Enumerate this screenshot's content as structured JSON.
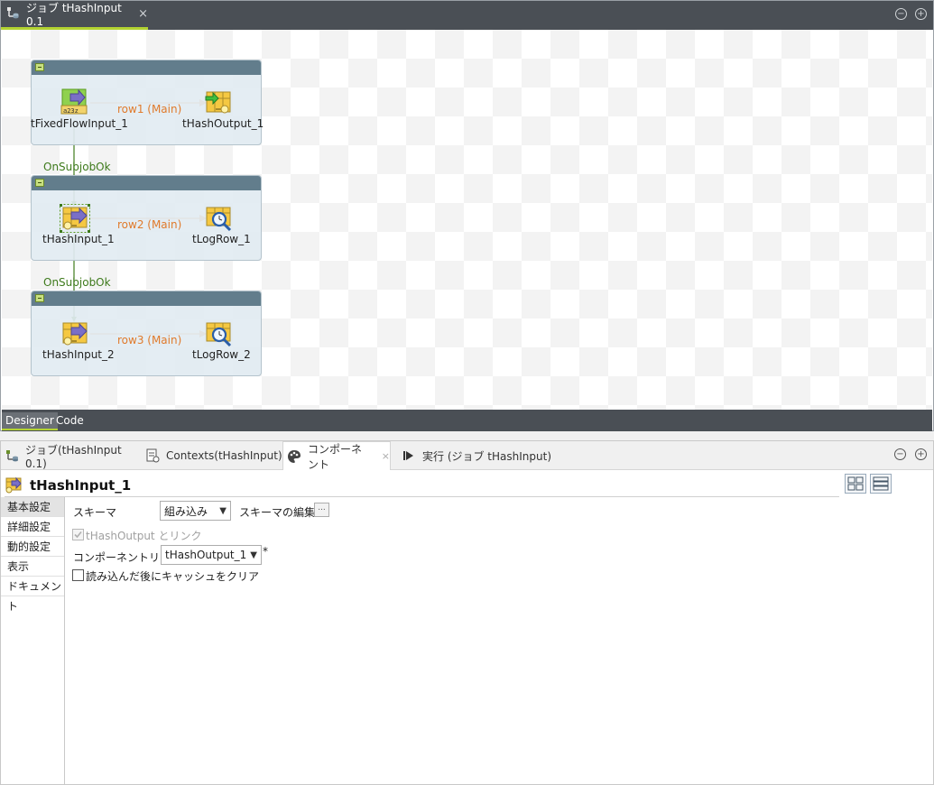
{
  "editor": {
    "tab_title": "ジョブ tHashInput 0.1",
    "tab_close": "×",
    "minimize": "−",
    "maximize": "+"
  },
  "canvas": {
    "components": {
      "fixed_flow_input": "tFixedFlowInput_1",
      "hash_output": "tHashOutput_1",
      "hash_input_1": "tHashInput_1",
      "log_row_1": "tLogRow_1",
      "hash_input_2": "tHashInput_2",
      "log_row_2": "tLogRow_2"
    },
    "flows": {
      "row1": "row1 (Main)",
      "row2": "row2 (Main)",
      "row3": "row3 (Main)"
    },
    "triggers": {
      "first": "OnSubjobOk",
      "second": "OnSubjobOk"
    },
    "fixed_flow_icon_text": "a23z"
  },
  "editor_bottom_tabs": {
    "designer": "Designer",
    "code": "Code"
  },
  "panel": {
    "tabs": {
      "job": "ジョブ(tHashInput 0.1)",
      "contexts": "Contexts(tHashInput)",
      "component": "コンポーネント",
      "run": "実行 (ジョブ tHashInput)"
    },
    "component_title": "tHashInput_1",
    "nav": {
      "basic": "基本設定",
      "advanced": "詳細設定",
      "dynamic": "動的設定",
      "view": "表示",
      "document": "ドキュメント"
    },
    "form": {
      "schema_label": "スキーマ",
      "schema_value": "組み込み",
      "schema_edit_label": "スキーマの編集",
      "schema_edit_button": "...",
      "link_checkbox_label": "tHashOutput とリンク",
      "component_list_label": "コンポーネントリスト",
      "component_list_value": "tHashOutput_1",
      "required_mark": "*",
      "clear_cache_label": "読み込んだ後にキャッシュをクリア"
    }
  },
  "colors": {
    "accent": "#b3d331",
    "flow": "#e07a2b",
    "trigger": "#3e7a1c",
    "subjob_header": "#627d8c"
  }
}
